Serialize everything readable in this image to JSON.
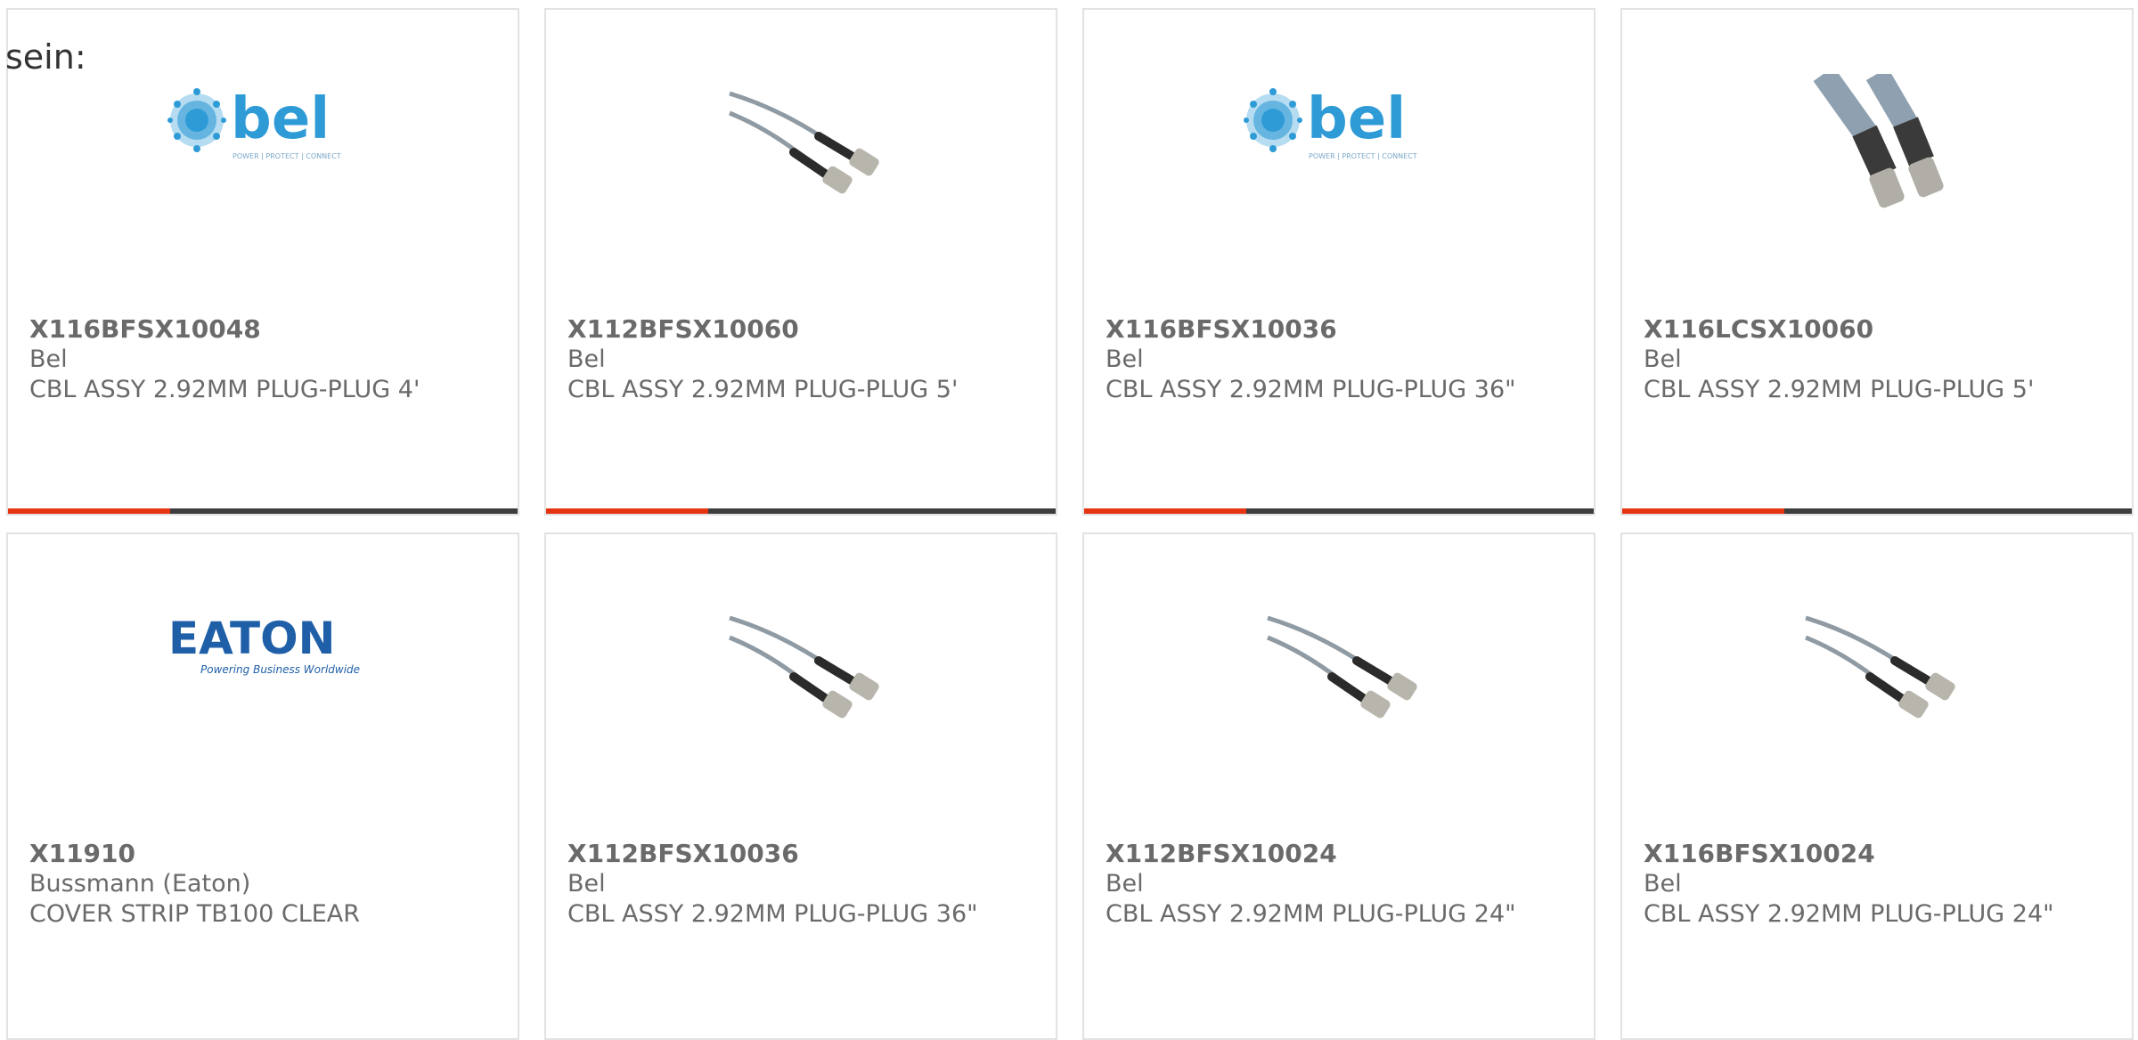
{
  "heading": "sein:",
  "accent_color": "#e63312",
  "bar_color": "#3d3d3d",
  "products": [
    {
      "part_number": "X116BFSX10048",
      "manufacturer": "Bel",
      "description": "CBL ASSY 2.92MM PLUG-PLUG 4'",
      "image": "bel-logo-icon",
      "brand_text": "bel",
      "brand_tagline": "POWER | PROTECT | CONNECT"
    },
    {
      "part_number": "X112BFSX10060",
      "manufacturer": "Bel",
      "description": "CBL ASSY 2.92MM PLUG-PLUG 5'",
      "image": "coax-cable-icon"
    },
    {
      "part_number": "X116BFSX10036",
      "manufacturer": "Bel",
      "description": "CBL ASSY 2.92MM PLUG-PLUG 36\"",
      "image": "bel-logo-icon",
      "brand_text": "bel",
      "brand_tagline": "POWER | PROTECT | CONNECT"
    },
    {
      "part_number": "X116LCSX10060",
      "manufacturer": "Bel",
      "description": "CBL ASSY 2.92MM PLUG-PLUG 5'",
      "image": "coax-cable-closeup-icon"
    },
    {
      "part_number": "X11910",
      "manufacturer": "Bussmann (Eaton)",
      "description": "COVER STRIP TB100 CLEAR",
      "image": "eaton-logo-icon",
      "brand_text": "EATON",
      "brand_tagline": "Powering Business Worldwide"
    },
    {
      "part_number": "X112BFSX10036",
      "manufacturer": "Bel",
      "description": "CBL ASSY 2.92MM PLUG-PLUG 36\"",
      "image": "coax-cable-icon"
    },
    {
      "part_number": "X112BFSX10024",
      "manufacturer": "Bel",
      "description": "CBL ASSY 2.92MM PLUG-PLUG 24\"",
      "image": "coax-cable-icon"
    },
    {
      "part_number": "X116BFSX10024",
      "manufacturer": "Bel",
      "description": "CBL ASSY 2.92MM PLUG-PLUG 24\"",
      "image": "coax-cable-icon"
    }
  ]
}
